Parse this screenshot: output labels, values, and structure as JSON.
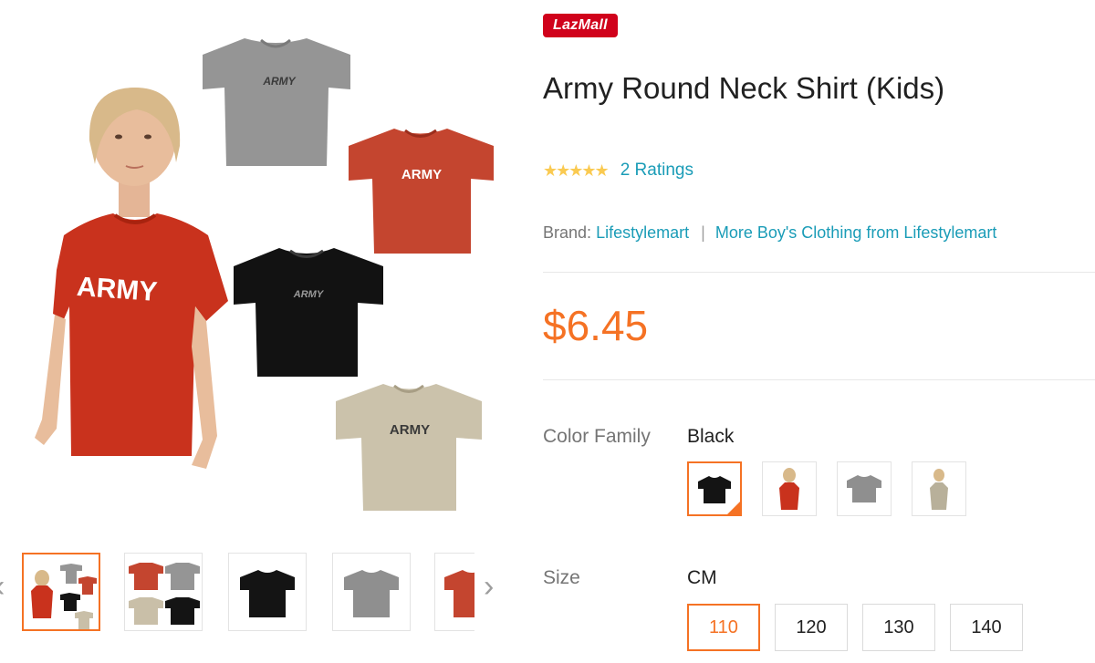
{
  "badge": "LazMall",
  "product": {
    "title": "Army Round Neck Shirt (Kids)",
    "stars": "★★★★★",
    "rating_value": 5,
    "ratings_label": "2 Ratings",
    "brand_label": "Brand:",
    "brand_name": "Lifestylemart",
    "brand_separator": "|",
    "more_link": "More Boy's Clothing from Lifestylemart",
    "price": "$6.45"
  },
  "hero": {
    "shirt_text_red": "ARMY",
    "shirt_text_grey": "ARMY",
    "shirt_text_black": "ARMY",
    "shirt_text_tan": "ARMY"
  },
  "gallery_nav": {
    "prev": "‹",
    "next": "›"
  },
  "color_family": {
    "label": "Color Family",
    "selected": "Black",
    "swatches": [
      "Black",
      "Red",
      "Grey",
      "Khaki"
    ]
  },
  "size": {
    "label": "Size",
    "unit": "CM",
    "options": [
      "110",
      "120",
      "130",
      "140"
    ],
    "selected": "110"
  },
  "colors": {
    "accent": "#f57224",
    "link": "#1a9cb7",
    "badge": "#d0011b",
    "star": "#faca51",
    "shirt_red": "#c73a22",
    "shirt_grey": "#8f8f8f",
    "shirt_black": "#141414",
    "shirt_tan": "#c9bfa8"
  }
}
